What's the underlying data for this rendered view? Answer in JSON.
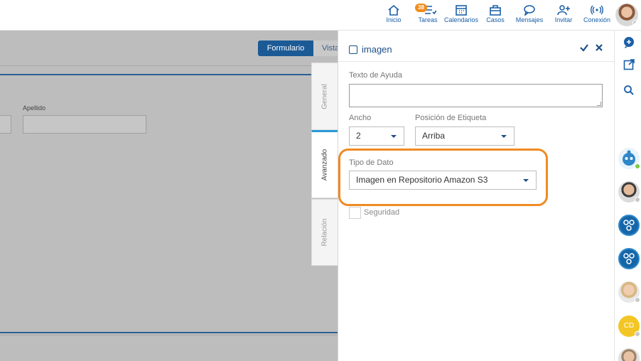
{
  "nav": {
    "items": [
      {
        "label": "Inicio",
        "icon": "home-icon"
      },
      {
        "label": "Tareas",
        "icon": "tasks-icon",
        "badge": "38"
      },
      {
        "label": "Calendarios",
        "icon": "calendar-icon"
      },
      {
        "label": "Casos",
        "icon": "briefcase-icon"
      },
      {
        "label": "Mensajes",
        "icon": "chat-icon"
      },
      {
        "label": "Invitar",
        "icon": "invite-user-icon"
      },
      {
        "label": "Conexión",
        "icon": "signal-icon"
      }
    ]
  },
  "background": {
    "formulario_label": "Formulario",
    "vista_label": "Vista",
    "apellido_label": "Apellido"
  },
  "tabs": {
    "general": "General",
    "avanzado": "Avanzado",
    "relacion": "Relación"
  },
  "panel": {
    "title": "imagen",
    "help_label": "Texto de Ayuda",
    "help_value": "",
    "ancho_label": "Ancho",
    "ancho_value": "2",
    "posicion_label": "Posición de Etiqueta",
    "posicion_value": "Arriba",
    "tipo_label": "Tipo de Dato",
    "tipo_value": "Imagen en Repositorio Amazon S3",
    "seguridad_label": "Seguridad"
  },
  "rail": {
    "cd_initials": "CD"
  },
  "colors": {
    "brand": "#1c5a96",
    "highlight": "#f08a24",
    "badge": "#f28c1b"
  }
}
